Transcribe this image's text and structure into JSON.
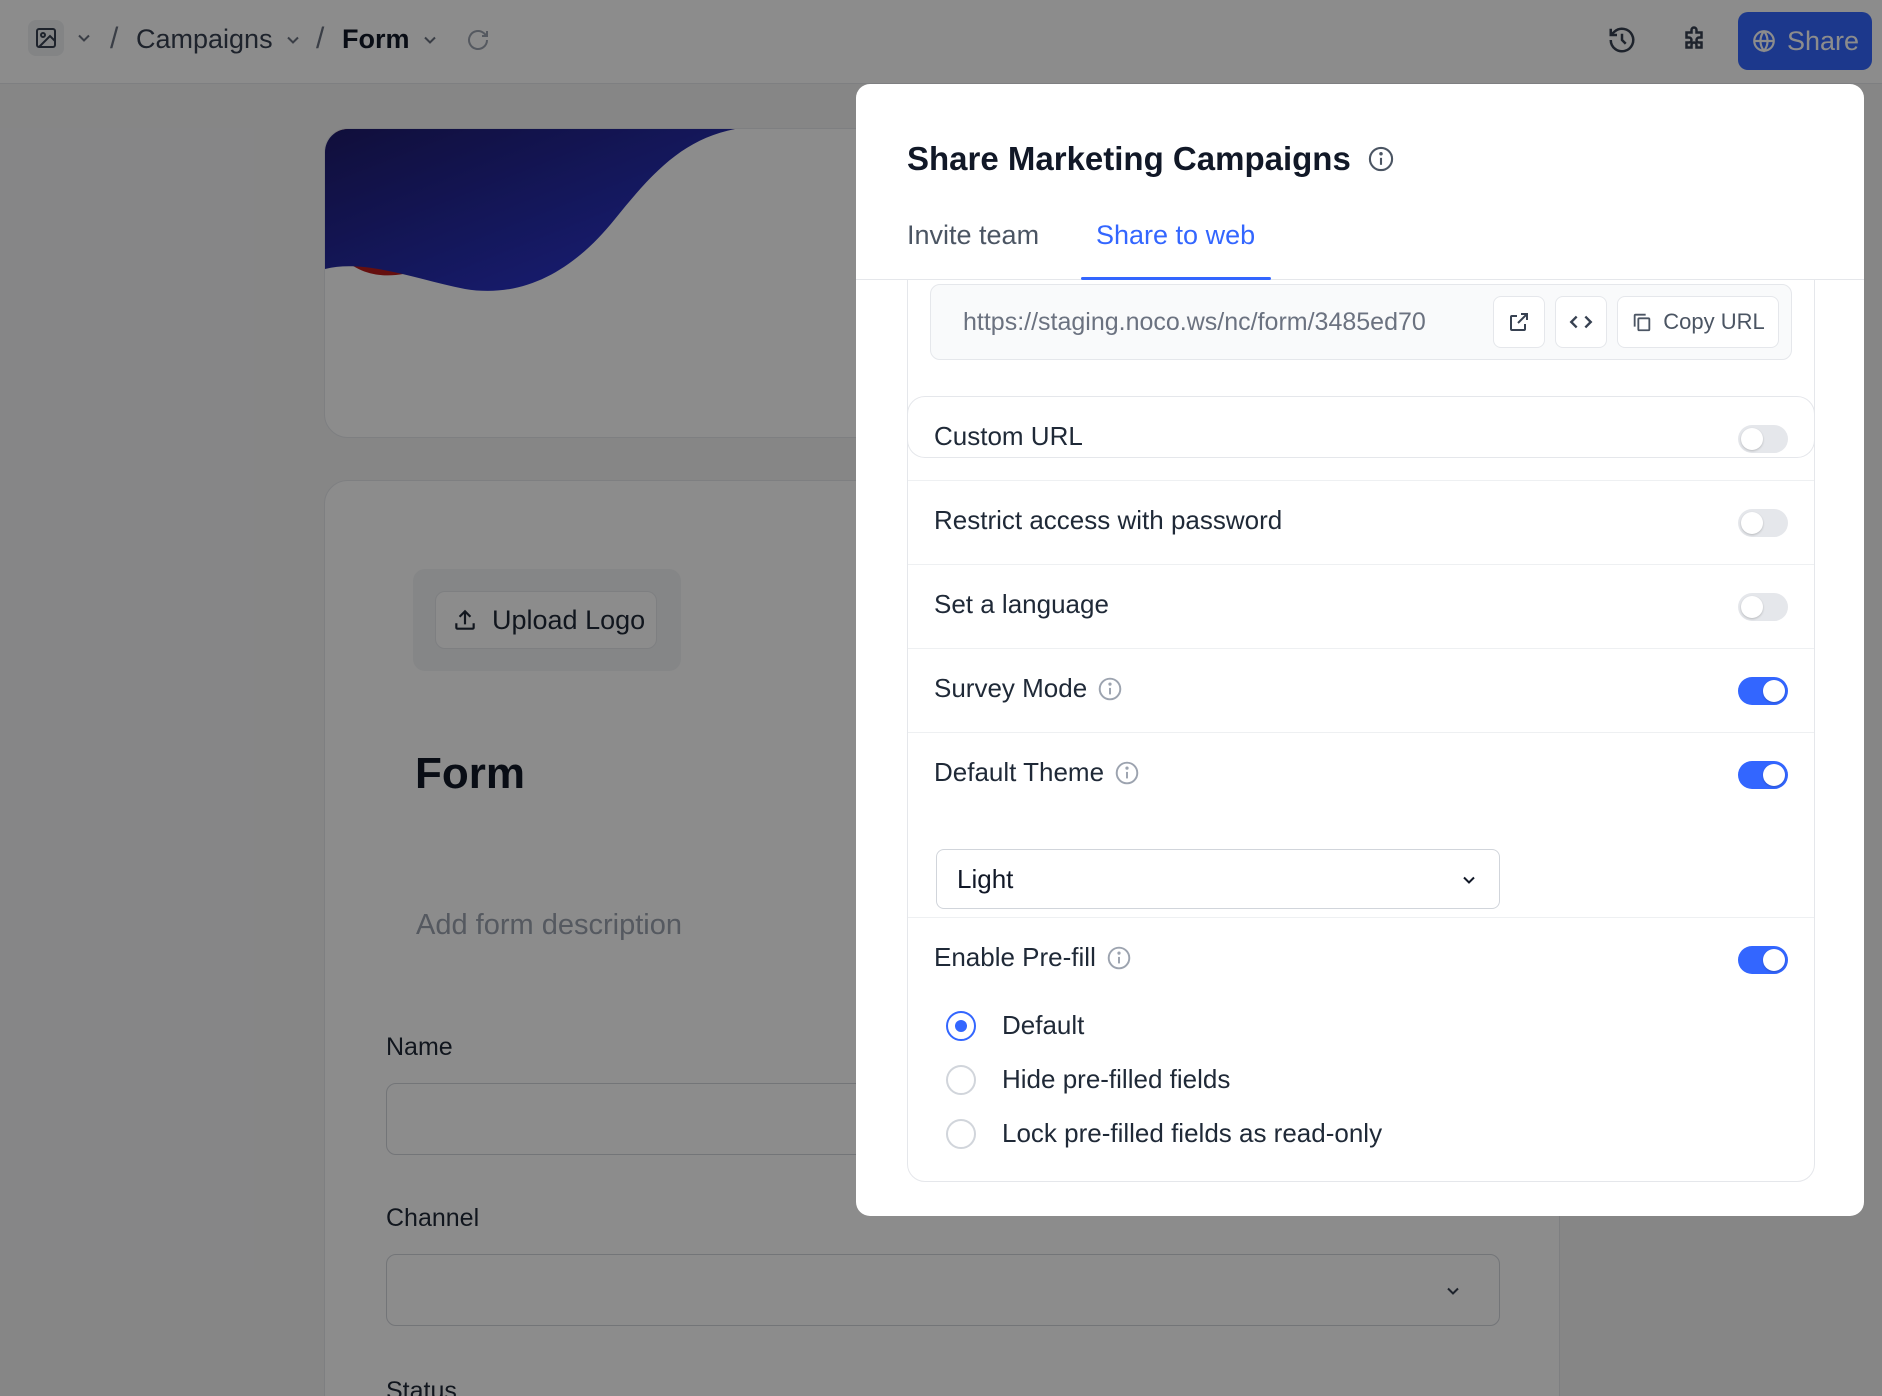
{
  "topbar": {
    "breadcrumb": [
      {
        "label": "Campaigns"
      },
      {
        "label": "Form"
      }
    ],
    "separator": "/",
    "share_label": "Share"
  },
  "form": {
    "upload_logo_label": "Upload Logo",
    "title": "Form",
    "description_placeholder": "Add form description",
    "fields": [
      {
        "label": "Name"
      },
      {
        "label": "Channel"
      },
      {
        "label": "Status"
      }
    ]
  },
  "modal": {
    "title": "Share Marketing Campaigns",
    "tabs": [
      {
        "label": "Invite team"
      },
      {
        "label": "Share to web"
      }
    ],
    "active_tab": "Share to web",
    "url": "https://staging.noco.ws/nc/form/3485ed70",
    "copy_url_label": "Copy URL",
    "settings": [
      {
        "label": "Custom URL",
        "enabled": false
      },
      {
        "label": "Restrict access with password",
        "enabled": false
      },
      {
        "label": "Set a language",
        "enabled": false
      },
      {
        "label": "Survey Mode",
        "enabled": true
      },
      {
        "label": "Default Theme",
        "enabled": true
      },
      {
        "label": "Enable Pre-fill",
        "enabled": true
      }
    ],
    "theme_select": {
      "value": "Light"
    },
    "prefill_options": [
      {
        "label": "Default",
        "selected": true
      },
      {
        "label": "Hide pre-filled fields",
        "selected": false
      },
      {
        "label": "Lock pre-filled fields as read-only",
        "selected": false
      }
    ]
  },
  "colors": {
    "accent": "#3366ff",
    "overlay": "rgba(0,0,0,0.45)"
  }
}
